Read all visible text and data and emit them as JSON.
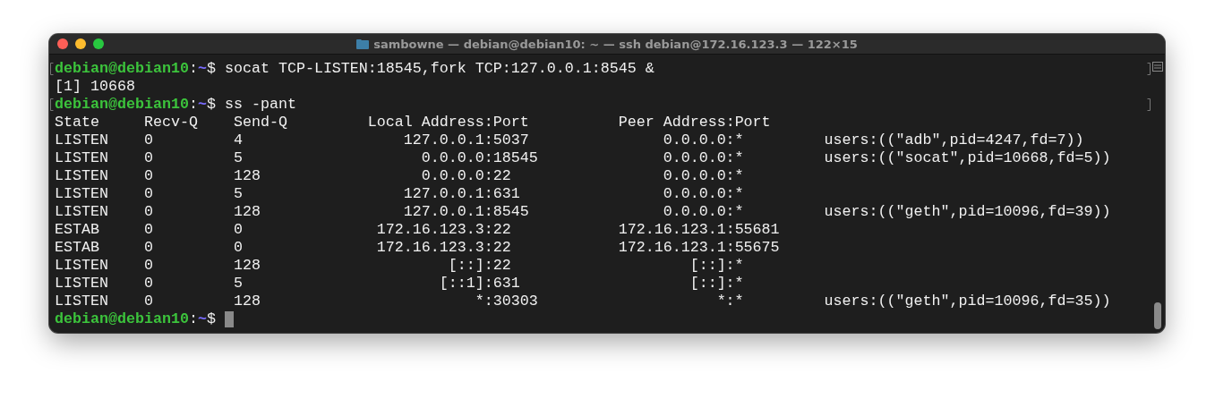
{
  "window": {
    "title": "sambowne — debian@debian10: ~ — ssh debian@172.16.123.3 — 122×15"
  },
  "lines": [
    {
      "kind": "prompt",
      "user": "debian@debian10",
      "separator": ":",
      "path": "~",
      "sigil": "$",
      "command": "socat TCP-LISTEN:18545,fork TCP:127.0.0.1:8545 &",
      "marked": true
    },
    {
      "kind": "output",
      "text": "[1] 10668"
    },
    {
      "kind": "prompt",
      "user": "debian@debian10",
      "separator": ":",
      "path": "~",
      "sigil": "$",
      "command": "ss -pant",
      "marked": true
    }
  ],
  "table": {
    "columns": [
      "State",
      "Recv-Q",
      "Send-Q",
      "Local Address:Port",
      "Peer Address:Port"
    ],
    "rows": [
      {
        "cells": [
          "LISTEN",
          "0",
          "4",
          "127.0.0.1:5037",
          "0.0.0.0:*"
        ],
        "process": "users:((\"adb\",pid=4247,fd=7))"
      },
      {
        "cells": [
          "LISTEN",
          "0",
          "5",
          "0.0.0.0:18545",
          "0.0.0.0:*"
        ],
        "process": "users:((\"socat\",pid=10668,fd=5))"
      },
      {
        "cells": [
          "LISTEN",
          "0",
          "128",
          "0.0.0.0:22",
          "0.0.0.0:*"
        ]
      },
      {
        "cells": [
          "LISTEN",
          "0",
          "5",
          "127.0.0.1:631",
          "0.0.0.0:*"
        ]
      },
      {
        "cells": [
          "LISTEN",
          "0",
          "128",
          "127.0.0.1:8545",
          "0.0.0.0:*"
        ],
        "process": "users:((\"geth\",pid=10096,fd=39))"
      },
      {
        "cells": [
          "ESTAB",
          "0",
          "0",
          "172.16.123.3:22",
          "172.16.123.1:55681"
        ]
      },
      {
        "cells": [
          "ESTAB",
          "0",
          "0",
          "172.16.123.3:22",
          "172.16.123.1:55675"
        ]
      },
      {
        "cells": [
          "LISTEN",
          "0",
          "128",
          "[::]:22",
          "[::]:*"
        ]
      },
      {
        "cells": [
          "LISTEN",
          "0",
          "5",
          "[::1]:631",
          "[::]:*"
        ]
      },
      {
        "cells": [
          "LISTEN",
          "0",
          "128",
          "*:30303",
          "*:*"
        ],
        "process": "users:((\"geth\",pid=10096,fd=35))"
      }
    ]
  },
  "final_prompt": {
    "user": "debian@debian10",
    "separator": ":",
    "path": "~",
    "sigil": "$",
    "cursor": true
  }
}
